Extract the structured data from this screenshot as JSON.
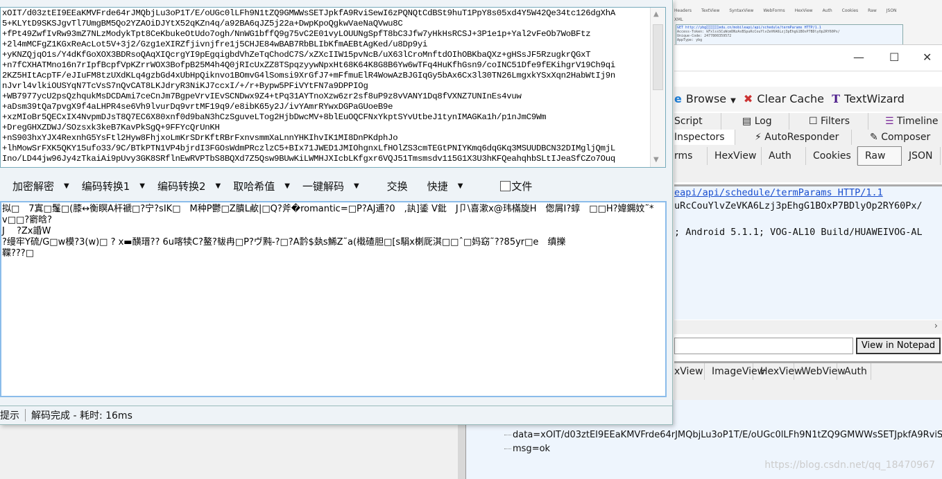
{
  "decoder_window": {
    "input_lines": [
      "xOIT/d03ztEI9EEaKMVFrde64rJMQbjLu3oP1T/E/oUGc0lLFh9N1tZQ9GMWWsSETJpkfA9RviSewI6zPQNQtCdBSt9huT1PpY8s05xd4Y5W42Qe34tc126dgXhA",
      "5+KLYtD9SKSJgvTl7UmgBM5Qo2YZAOiDJYtX52qKZn4q/a92BA6qJZ5j22a+DwpKpoQgkwVaeNaQVwu8C",
      "+fPt49ZwfIvRw93mZ7NLzModykTpt8CeKbukeOtUdo7ogh/NnWG1bffQ9g75vC2E01vyLOUUNgSpfT8bC3Jfw7yHkHsRCSJ+3P1e1p+Yal2vFeOb7WoBFtz",
      "+2l4mMCFgZ1KGxReAcLot5V+3j2/Gzg1eXIRZfjivnjfre1j5CHJE84wBAB7RbBLIbKfmAEBtAgKed/u8Dp9yi",
      "+yKNZQjqO1s/Y4dKfGoXOX3BDRsoQAqXIQcrgYI9pEgqigbdVhZeTqChodC7S/xZXcIIW15pvNcB/uX63lCroMnftdOIhOBKbaQXz+gHSsJF5RzugkrQGxT",
      "+n7fCXHATMno16n7rIpfBcpfVpKZrrWOX3BofpB25M4h4Q0jRIcUxZZ8TSpqzyywNpxHt68K64K8G8B6Yw6wTFq4HuKfhGsn9/coINC51Dfe9fEKihgrV19Ch9qi",
      "2KZ5HItAcpTF/eJIuFM8tzUXdKLq4gzbGd4xUbHpQiknvo1BOmvG4lSomsi9XrGfJ7+mFfmuElR4WowAzBJGIqGy5bAx6Cx3l30TN26LmgxkYSxXqn2HabWtIj9n",
      "nJvrl4vlkiOUSYqN7TcVsS7nQvCAT8LKJdryR3NiKJ7ccxI/+/r+Bypw5PFiVYtFN7a9DPPIOg",
      "+WB7977ycU2psQzhqukMsDCDAmi7ceCnJm7BgpeVrvIEvSCNDwx9Z4+tPq31AYTnoXzw6zr2sf8uP9z8vVANY1Dq8fVXNZ7UNInEs4vuw",
      "+aDsm39tQa7pvgX9f4aLHPR4se6Vh9lvurDq9vrtMF19q9/e8ibK65y2J/ivYAmrRYwxDGPaGUoeB9e",
      "+xzMIoBr5QECxIX4NvpmDJsT8Q7EC6X80xnf0d9baN3hCzSguveLTog2HjbDwcMV+8blEuOQCFNxYkptSYvUtbeJ1tynIMAGKa1h/p1nJmC9Wm",
      "+DregGHXZDWJ/SOzsxk3keB7KavPkSgQ+9FFYcQrUnKH",
      "+nS903hxYJX4RexnhG5YsFtl2Hyw8FhjxoLmKrSDrKftRBrFxnvsmmXaLnnYHKIhvIK1MI8DnPKdphJo",
      "+lhMowSrFXK5QKY15ufo33/9C/BTkPTN1VP4bjrdI3FGOsWdmPRczlzC5+BIx71JWED1JMIOhgnxLfHOlZS3cmTEGtPNIYKmq6dqGKq3MSUUDBCN32DIMgljQmjL",
      "Ino/LD44jw96Jy4zTkaiAi9pUvy3GK8SRflnEwRVPTbS8BQXd7Z5Qsw9BUwKiLWMHJXIcbLKfgxr6VQJ51Tmsmsdv115G1X3U3hKFQeahqhbSLtIJeaSfCZo7Ouq"
    ],
    "toolbar": [
      {
        "label": "加密解密",
        "dropdown": true
      },
      {
        "label": "编码转换1",
        "dropdown": true
      },
      {
        "label": "编码转换2",
        "dropdown": true
      },
      {
        "label": "取哈希值",
        "dropdown": true
      },
      {
        "label": "一键解码",
        "dropdown": true
      },
      {
        "label": "交换",
        "dropdown": false
      },
      {
        "label": "快捷",
        "dropdown": true
      }
    ],
    "file_checkbox": {
      "label": "文件",
      "checked": false
    },
    "output_text": "拟□　7寘□鬔□(膝↔衡瞑A杆褫□?宁?sIK□　M种P鬱□Z膭L欳|□Q?斧�romantic=□P?AJ逋?0　,訙]鋈 V鈚　J卩\\喜漱x@玮樠旋H　偬屑I?蜳　□□H?媁鐊妏˜*　v□□?窬晗?\nJ　 ?Zx諙W\n?缦牢Y硫/G□w模?3(w)□ ? x▬䤑瑨?? 6u喀犊C?鳌?韨冉□P?ヴ黗-?□?A霒$埶s鯑Z˜a(橶碴胆□[s駽x楋厑淇□□ˆ□妈窈˜??85yr□e　缜擽\n鞢???□",
    "status": {
      "label": "提示",
      "message": "解码完成 - 耗时: 16ms"
    }
  },
  "fiddler": {
    "thumb_tabs": [
      "Headers",
      "TextView",
      "SyntaxView",
      "WebForms",
      "HexView",
      "Auth",
      "Cookies",
      "Raw",
      "JSON",
      "XML"
    ],
    "thumb_lines": [
      "GET http://ybg░░░░░░edu.cn/mobileapi/api/schedule/termParams HTTP/1.1",
      "Access-Token: kFxlssSCuWcmDNzAsBSpuRcCouYlvZeVKA6Lzj3pEhgG1BOxP7BDlyOp2RY60Px/",
      "Unique-Code: 247780035957​2",
      "AppType: ybg"
    ],
    "window_controls": {
      "minimize": "—",
      "maximize": "☐",
      "close": "✕"
    },
    "toolbar": [
      "Browse",
      "Clear Cache",
      "TextWizard"
    ],
    "tabs_row1": [
      "Script",
      "Log",
      "Filters",
      "Timeline"
    ],
    "tabs_row2": [
      "Inspectors",
      "AutoResponder",
      "Composer"
    ],
    "request_tabs": [
      "rms",
      "HexView",
      "Auth",
      "Cookies",
      "Raw",
      "JSON"
    ],
    "request_lines": {
      "link": "eapi/api/schedule/termParams HTTP/1.1",
      "token": "uRcCouYlvZeVKA6Lzj3pEhgG1BOxP7BDlyOp2RY60Px/",
      "ua": "; Android 5.1.1; VOG-AL10 Build/HUAWEIVOG-AL"
    },
    "view_in_notepad": "View in Notepad",
    "response_tabs": [
      "xView",
      "ImageView",
      "HexView",
      "WebView",
      "Auth"
    ],
    "tree": [
      "data=xOIT/d03ztEI9EEaKMVFrde64rJMQbjLu3oP1T/E/oUGc0lLFh9N1tZQ9GMWWsSETJpkfA9RviSewI6zPQ",
      "msg=ok"
    ]
  },
  "watermark": "https://blog.csdn.net/qq_18470967"
}
